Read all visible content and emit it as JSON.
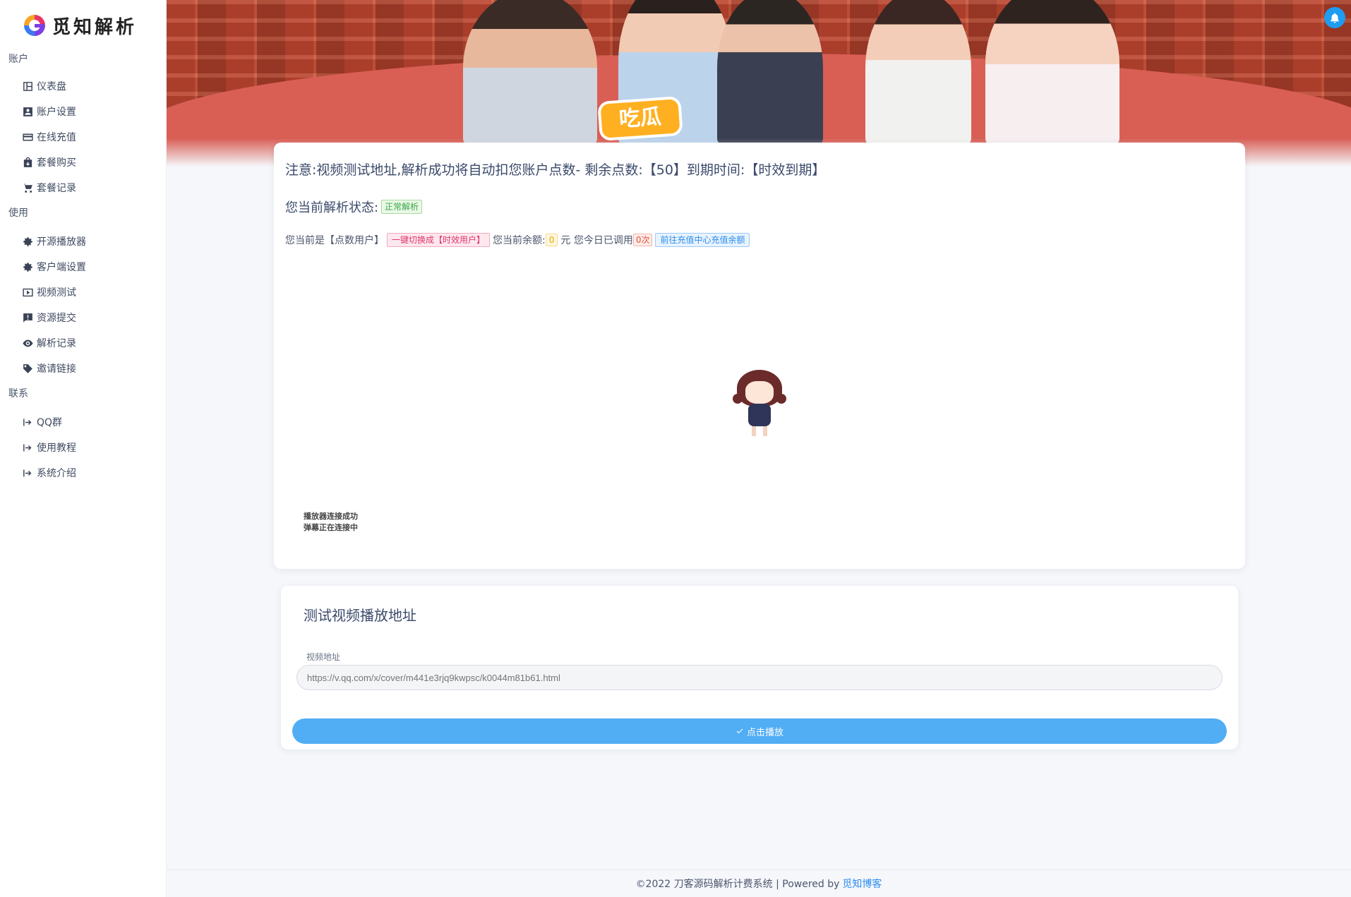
{
  "brand": {
    "name": "觅知解析"
  },
  "sidebar": {
    "sections": [
      {
        "title": "账户",
        "items": [
          {
            "label": "仪表盘",
            "icon": "dashboard-icon"
          },
          {
            "label": "账户设置",
            "icon": "account-box-icon"
          },
          {
            "label": "在线充值",
            "icon": "credit-card-icon"
          },
          {
            "label": "套餐购买",
            "icon": "shopping-bag-icon"
          },
          {
            "label": "套餐记录",
            "icon": "cart-icon"
          }
        ]
      },
      {
        "title": "使用",
        "items": [
          {
            "label": "开源播放器",
            "icon": "gear-icon"
          },
          {
            "label": "客户端设置",
            "icon": "gear-icon"
          },
          {
            "label": "视频测试",
            "icon": "video-icon"
          },
          {
            "label": "资源提交",
            "icon": "alert-icon"
          },
          {
            "label": "解析记录",
            "icon": "eye-icon"
          },
          {
            "label": "邀请链接",
            "icon": "tag-icon"
          }
        ]
      },
      {
        "title": "联系",
        "items": [
          {
            "label": "QQ群",
            "icon": "arrow-right-icon"
          },
          {
            "label": "使用教程",
            "icon": "arrow-right-icon"
          },
          {
            "label": "系统介绍",
            "icon": "arrow-right-icon"
          }
        ]
      }
    ]
  },
  "banner": {
    "badge": "吃瓜"
  },
  "status_card": {
    "notice": "注意:视频测试地址,解析成功将自动扣您账户点数- 剩余点数:【50】到期时间:【时效到期】",
    "status_label": "您当前解析状态:",
    "status_tag": "正常解析",
    "user_prefix": "您当前是【点数用户】",
    "switch_tag": "一键切换成【时效用户】",
    "balance_label": "您当前余额:",
    "balance_value": "0",
    "balance_unit": "元 您今日已调用",
    "calls_today": "0次",
    "recharge_tag": "前往充值中心充值余额",
    "player_status_1": "播放器连接成功",
    "player_status_2": "弹幕正在连接中"
  },
  "test_card": {
    "title": "测试视频播放地址",
    "field_label": "视频地址",
    "field_placeholder": "https://v.qq.com/x/cover/m441e3rjq9kwpsc/k0044m81b61.html",
    "button_label": "点击播放"
  },
  "footer": {
    "text": "©2022 刀客源码解析计费系统 | Powered by",
    "link_text": "觅知博客"
  },
  "colors": {
    "accent": "#52aef4",
    "bell": "#1e9cf0",
    "link": "#2d8cf0"
  }
}
